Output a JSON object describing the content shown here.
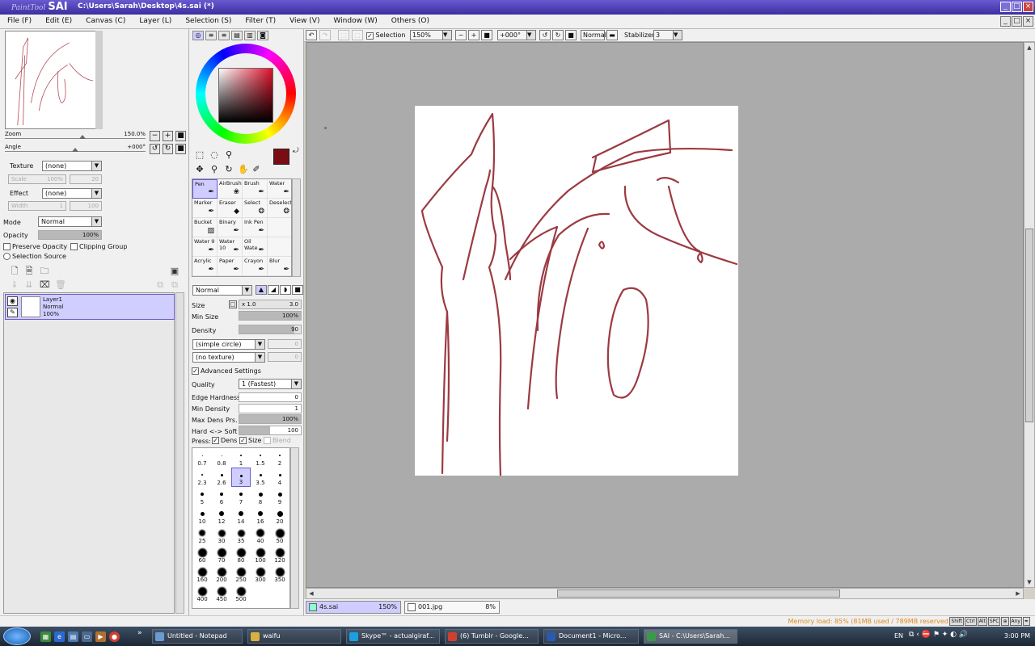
{
  "titlebar": {
    "logo_small": "PaintTool",
    "logo_big": "SAI",
    "path": "C:\\Users\\Sarah\\Desktop\\4s.sai (*)"
  },
  "menu": [
    "File (F)",
    "Edit (E)",
    "Canvas (C)",
    "Layer (L)",
    "Selection (S)",
    "Filter (T)",
    "View (V)",
    "Window (W)",
    "Others (O)"
  ],
  "navigator": {
    "zoom_label": "Zoom",
    "zoom_value": "150.0%",
    "angle_label": "Angle",
    "angle_value": "+000°"
  },
  "layer_props": {
    "texture_label": "Texture",
    "texture_value": "(none)",
    "scale_label": "Scale",
    "scale_value": "100%",
    "scale_num": "20",
    "effect_label": "Effect",
    "effect_value": "(none)",
    "width_label": "Width",
    "width_value": "1",
    "width_num": "100",
    "mode_label": "Mode",
    "mode_value": "Normal",
    "opacity_label": "Opacity",
    "opacity_value": "100%",
    "preserve_opacity": "Preserve Opacity",
    "clipping_group": "Clipping Group",
    "selection_source": "Selection Source"
  },
  "layer": {
    "name": "Layer1",
    "mode": "Normal",
    "opacity": "100%"
  },
  "tools": [
    {
      "label": "Pen",
      "icon": "pen-icon",
      "glyph": "✒"
    },
    {
      "label": "AirBrush",
      "icon": "airbrush-icon",
      "glyph": "❀"
    },
    {
      "label": "Brush",
      "icon": "brush-icon",
      "glyph": "✒"
    },
    {
      "label": "Water",
      "icon": "water-icon",
      "glyph": "✒"
    },
    {
      "label": "Marker",
      "icon": "marker-icon",
      "glyph": "✒"
    },
    {
      "label": "Eraser",
      "icon": "eraser-icon",
      "glyph": "◆"
    },
    {
      "label": "Select",
      "icon": "select-icon",
      "glyph": "❂"
    },
    {
      "label": "Deselect",
      "icon": "deselect-icon",
      "glyph": "❂"
    },
    {
      "label": "Bucket",
      "icon": "bucket-icon",
      "glyph": "▧"
    },
    {
      "label": "Binary",
      "icon": "binary-icon",
      "glyph": "✒"
    },
    {
      "label": "Ink Pen",
      "icon": "ink-pen-icon",
      "glyph": "✒"
    },
    {
      "label": "",
      "icon": "",
      "glyph": ""
    },
    {
      "label": "Water 9",
      "icon": "water-icon",
      "glyph": "✒"
    },
    {
      "label": "Water 10",
      "icon": "water-icon",
      "glyph": "✒"
    },
    {
      "label": "Oil Wate",
      "icon": "oil-water-icon",
      "glyph": "✒"
    },
    {
      "label": "",
      "icon": "",
      "glyph": ""
    },
    {
      "label": "Acrylic",
      "icon": "acrylic-icon",
      "glyph": "✒"
    },
    {
      "label": "Paper",
      "icon": "paper-icon",
      "glyph": "✒"
    },
    {
      "label": "Crayon",
      "icon": "crayon-icon",
      "glyph": "✒"
    },
    {
      "label": "Blur",
      "icon": "blur-icon",
      "glyph": "✒"
    }
  ],
  "brush_settings": {
    "blend_mode": "Normal",
    "size_label": "Size",
    "size_mult": "x 1.0",
    "size_value": "3.0",
    "min_size_label": "Min Size",
    "min_size_value": "100%",
    "density_label": "Density",
    "density_value": "90",
    "shape": "(simple circle)",
    "shape_num": "0",
    "texture": "(no texture)",
    "texture_num": "0",
    "advanced_label": "Advanced Settings",
    "quality_label": "Quality",
    "quality_value": "1 (Fastest)",
    "edge_hardness_label": "Edge Hardness",
    "edge_hardness_value": "0",
    "min_density_label": "Min Density",
    "min_density_value": "1",
    "max_dens_label": "Max Dens Prs.",
    "max_dens_value": "100%",
    "hard_soft_label": "Hard <-> Soft",
    "hard_soft_value": "100",
    "press_label": "Press:",
    "press_dens": "Dens",
    "press_size": "Size",
    "press_blend": "Blend"
  },
  "brush_sizes": [
    "0.7",
    "0.8",
    "1",
    "1.5",
    "2",
    "2.3",
    "2.6",
    "3",
    "3.5",
    "4",
    "5",
    "6",
    "7",
    "8",
    "9",
    "10",
    "12",
    "14",
    "16",
    "20",
    "25",
    "30",
    "35",
    "40",
    "50",
    "60",
    "70",
    "80",
    "100",
    "120",
    "160",
    "200",
    "250",
    "300",
    "350",
    "400",
    "450",
    "500"
  ],
  "canvas_toolbar": {
    "selection_label": "Selection",
    "zoom": "150%",
    "angle": "+000°",
    "mode": "Normal",
    "stabilizer_label": "Stabilizer",
    "stabilizer_value": "3"
  },
  "doc_tabs": [
    {
      "name": "4s.sai",
      "zoom": "150%"
    },
    {
      "name": "001.jpg",
      "zoom": "8%"
    }
  ],
  "status": {
    "memory": "Memory load: 85% (81MB used / 789MB reserved)",
    "keys": [
      "Shift",
      "Ctrl",
      "Alt",
      "SPC",
      "⊕",
      "Any",
      "✒"
    ]
  },
  "taskbar": {
    "tasks": [
      "Untitled - Notepad",
      "waifu",
      "Skype™ - actualgiraf...",
      "(6) Tumblr - Google...",
      "Document1 - Micro...",
      "SAI - C:\\Users\\Sarah..."
    ],
    "lang": "EN",
    "time": "3:00 PM"
  },
  "colors": {
    "main": "#7a0d14",
    "sub": "#ffffff",
    "accent": "#6a5acd",
    "stroke": "#9c3a42"
  }
}
